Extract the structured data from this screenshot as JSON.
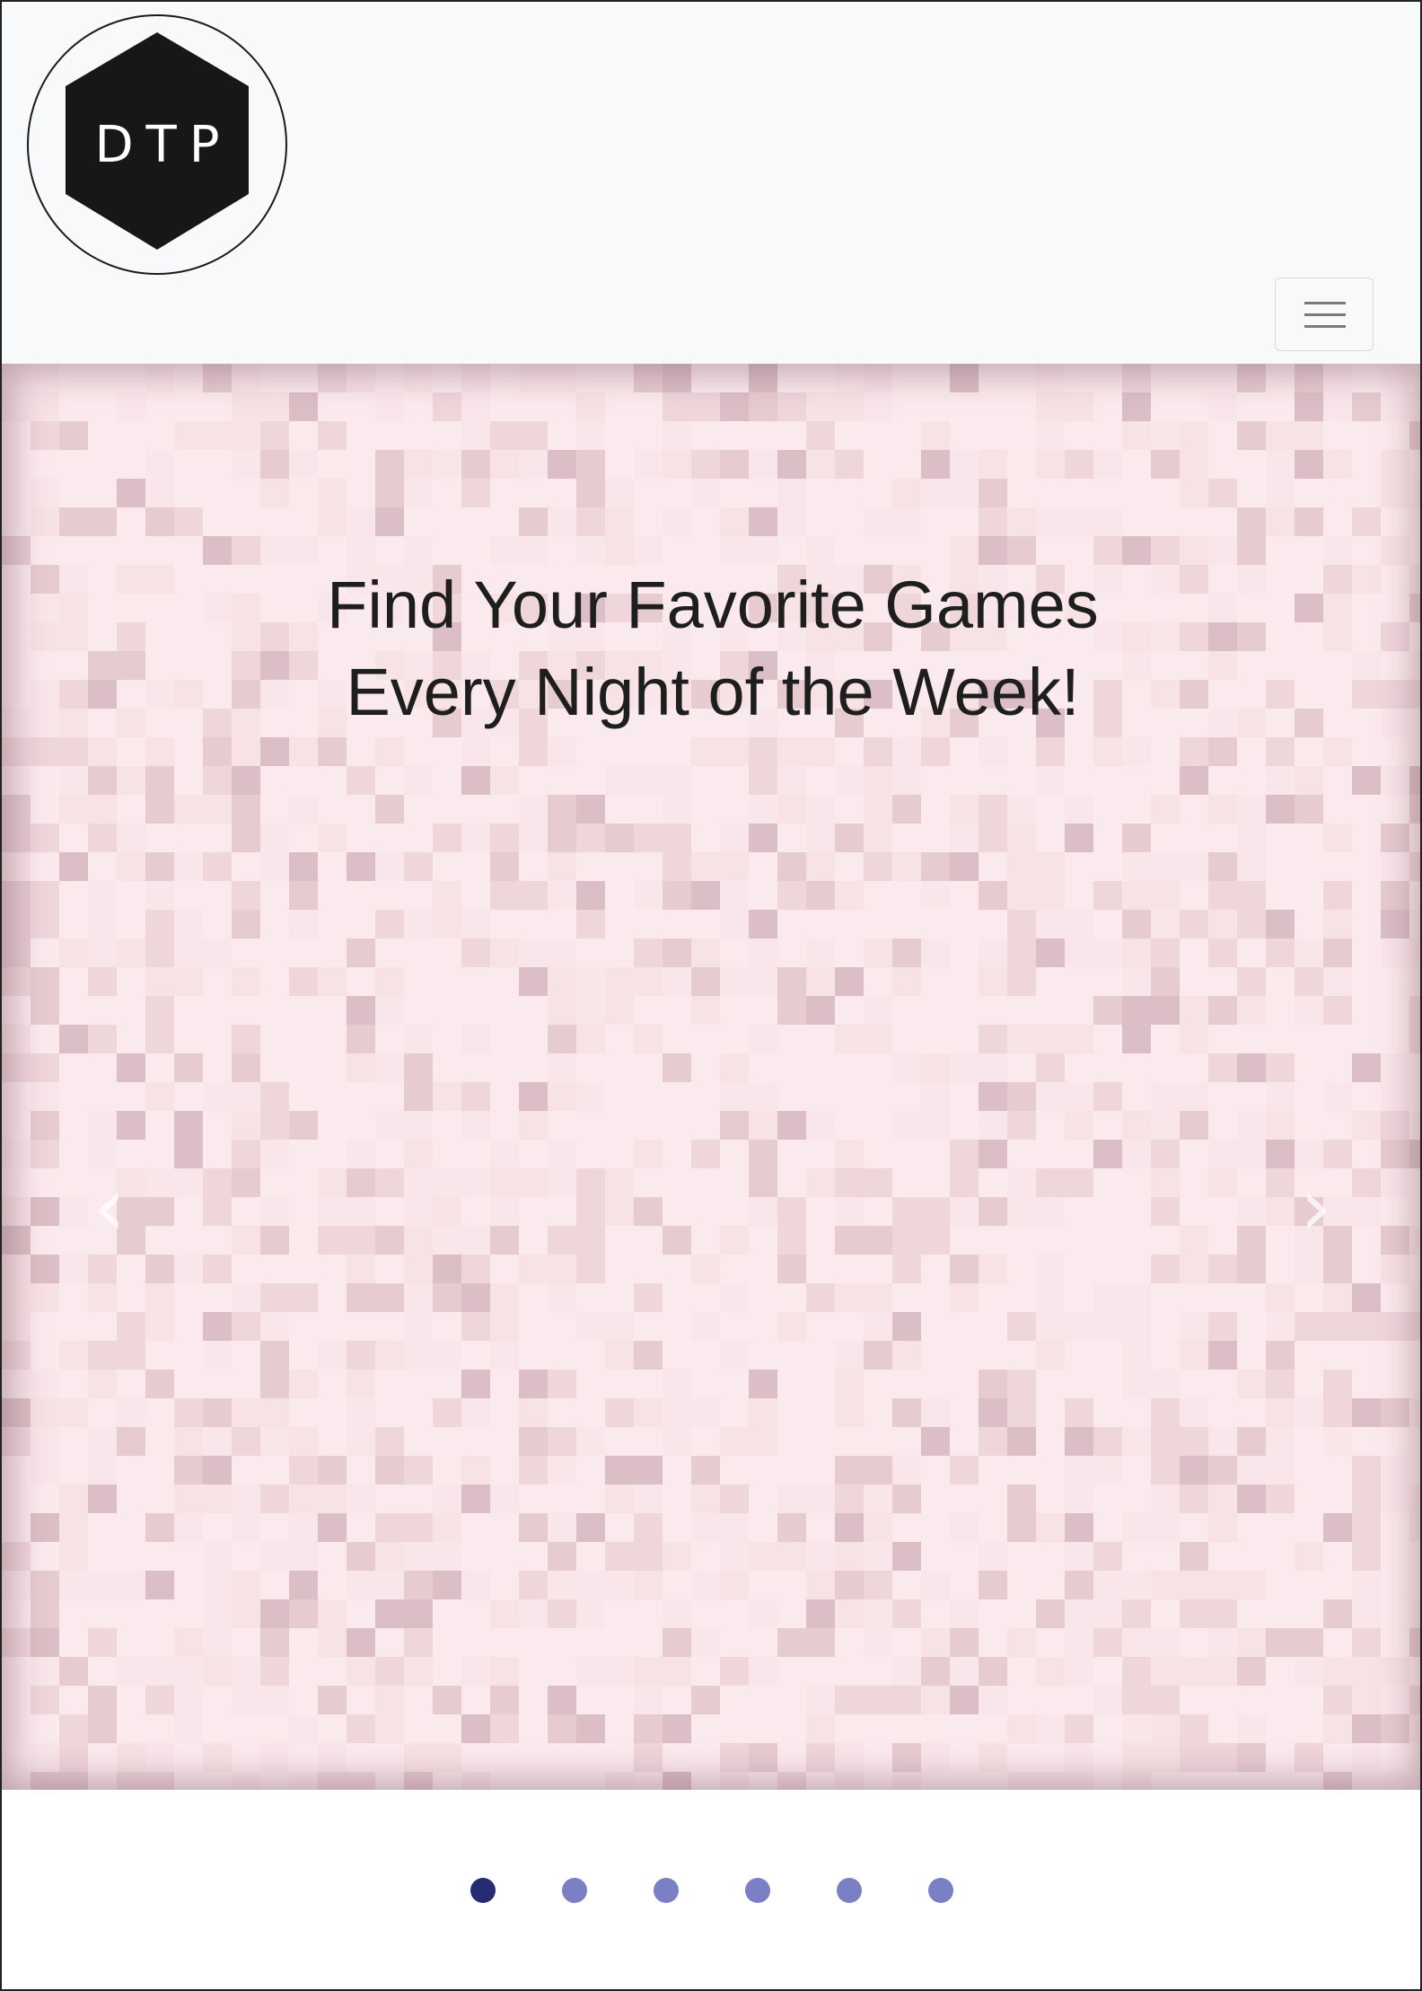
{
  "header": {
    "logo_text": "DTP",
    "logo_alt": "DTP logo",
    "menu_icon": "hamburger-menu-icon"
  },
  "carousel": {
    "caption_line1": "Find Your Favorite Games",
    "caption_line2": "Every Night of the Week!",
    "prev_icon": "chevron-left-icon",
    "prev_glyph": "‹",
    "next_icon": "chevron-right-icon",
    "next_glyph": "›",
    "slide_count": 6,
    "active_index": 0,
    "colors": {
      "indicator_active": "#272b74",
      "indicator_inactive": "#7b7fc4",
      "background": "#fbeaed"
    }
  }
}
